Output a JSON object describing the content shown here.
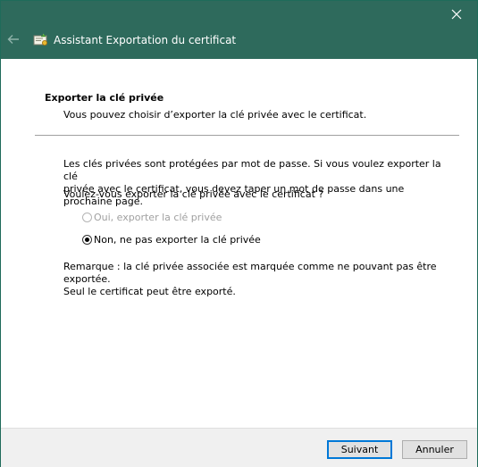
{
  "window": {
    "title": "Assistant Exportation du certificat",
    "close_glyph": "✕",
    "back_glyph": "←"
  },
  "header": {
    "title": "Exporter la clé privée",
    "subtitle": "Vous pouvez choisir d’exporter la clé privée avec le certificat."
  },
  "body": {
    "intro": "Les clés privées sont protégées par mot de passe. Si vous voulez exporter la clé\nprivée avec le certificat, vous devez taper un mot de passe dans une prochaine page.",
    "question": "Voulez-vous exporter la clé privée avec le certificat ?",
    "options": [
      {
        "label": "Oui, exporter la clé privée",
        "selected": false,
        "enabled": false
      },
      {
        "label": "Non, ne pas exporter la clé privée",
        "selected": true,
        "enabled": true
      }
    ],
    "note": "Remarque : la clé privée associée est marquée comme ne pouvant pas être exportée.\nSeul le certificat peut être exporté."
  },
  "footer": {
    "next_label": "Suivant",
    "cancel_label": "Annuler"
  },
  "colors": {
    "titlebar": "#2e6a5c",
    "primary_border": "#0078d7"
  }
}
